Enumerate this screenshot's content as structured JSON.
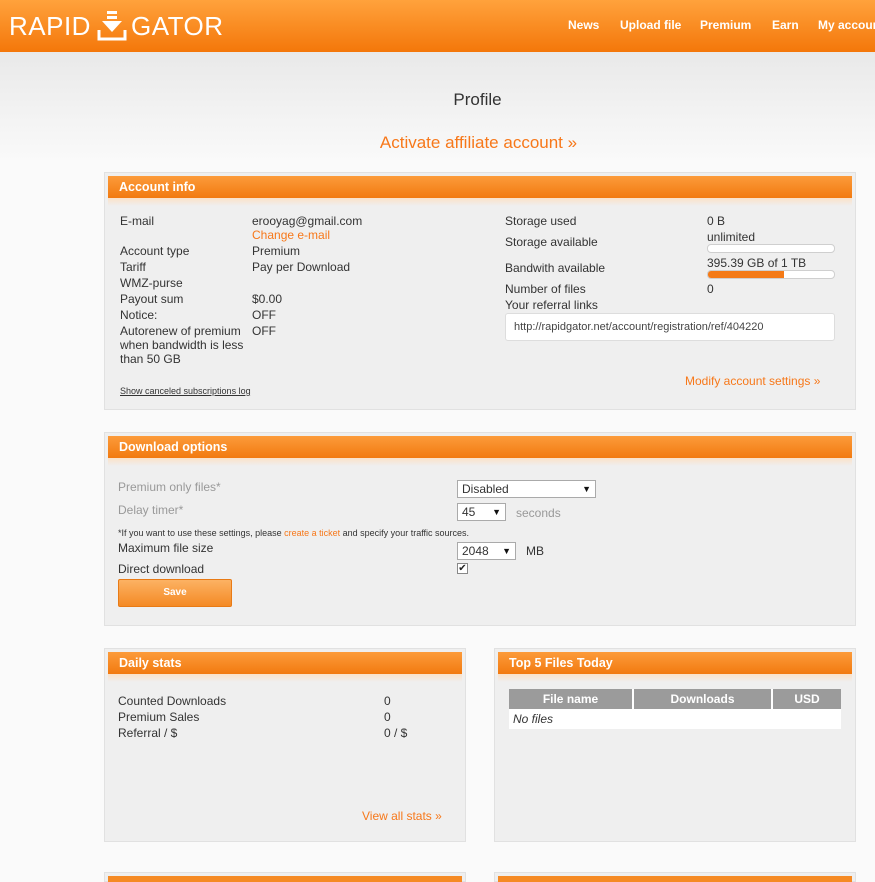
{
  "header": {
    "logo_left": "RAPID",
    "logo_right": "GATOR",
    "nav": [
      "News",
      "Upload file",
      "Premium",
      "Earn",
      "My account"
    ]
  },
  "page": {
    "title": "Profile",
    "affiliate_link": "Activate affiliate account »"
  },
  "account_info": {
    "heading": "Account info",
    "email_label": "E-mail",
    "email_value": "erooyag@gmail.com",
    "change_email": "Change e-mail",
    "account_type_label": "Account type",
    "account_type_value": "Premium",
    "tariff_label": "Tariff",
    "tariff_value": "Pay per Download",
    "wmz_label": "WMZ-purse",
    "payout_label": "Payout sum",
    "payout_value": "$0.00",
    "notice_label": "Notice:",
    "notice_value": "OFF",
    "autorenew_label": "Autorenew of premium when bandwidth is less than 50 GB",
    "autorenew_value": "OFF",
    "canceled_log": "Show canceled subscriptions log",
    "storage_used_label": "Storage used",
    "storage_used_value": "0 B",
    "storage_available_label": "Storage available",
    "storage_available_value": "unlimited",
    "storage_progress": 0,
    "bandwidth_label": "Bandwith available",
    "bandwidth_value": "395.39 GB of 1 TB",
    "bandwidth_progress": 0.6,
    "files_label": "Number of files",
    "files_value": "0",
    "referral_label": "Your referral links",
    "referral_url": "http://rapidgator.net/account/registration/ref/404220",
    "modify_settings": "Modify account settings »"
  },
  "download_options": {
    "heading": "Download options",
    "premium_only_label": "Premium only files*",
    "premium_only_value": "Disabled",
    "delay_label": "Delay timer*",
    "delay_value": "45",
    "delay_unit": "seconds",
    "note_star": "*",
    "note_before": "If you want to use these settings, please ",
    "note_link": "create a ticket",
    "note_after": " and specify your traffic sources.",
    "max_size_label": "Maximum file size",
    "max_size_value": "2048",
    "max_size_unit": "MB",
    "direct_label": "Direct download",
    "direct_checked": "✔",
    "save": "Save"
  },
  "daily_stats": {
    "heading": "Daily stats",
    "rows": [
      {
        "label": "Counted Downloads",
        "value": "0"
      },
      {
        "label": "Premium Sales",
        "value": "0"
      },
      {
        "label": "Referral / $",
        "value": "0 / $"
      }
    ],
    "view_all": "View all stats »"
  },
  "top_files": {
    "heading": "Top 5 Files Today",
    "columns": [
      "File name",
      "Downloads",
      "USD"
    ],
    "empty": "No files"
  },
  "colors": {
    "accent": "#f7781a",
    "header_top": "#ffa23c",
    "header_bottom": "#f4770a",
    "panel_bg": "#efefef",
    "table_head": "#9b9b9b"
  },
  "icons": {
    "logo": "download-arrow-icon",
    "select": "chevron-down-icon",
    "checkbox": "check-icon"
  }
}
